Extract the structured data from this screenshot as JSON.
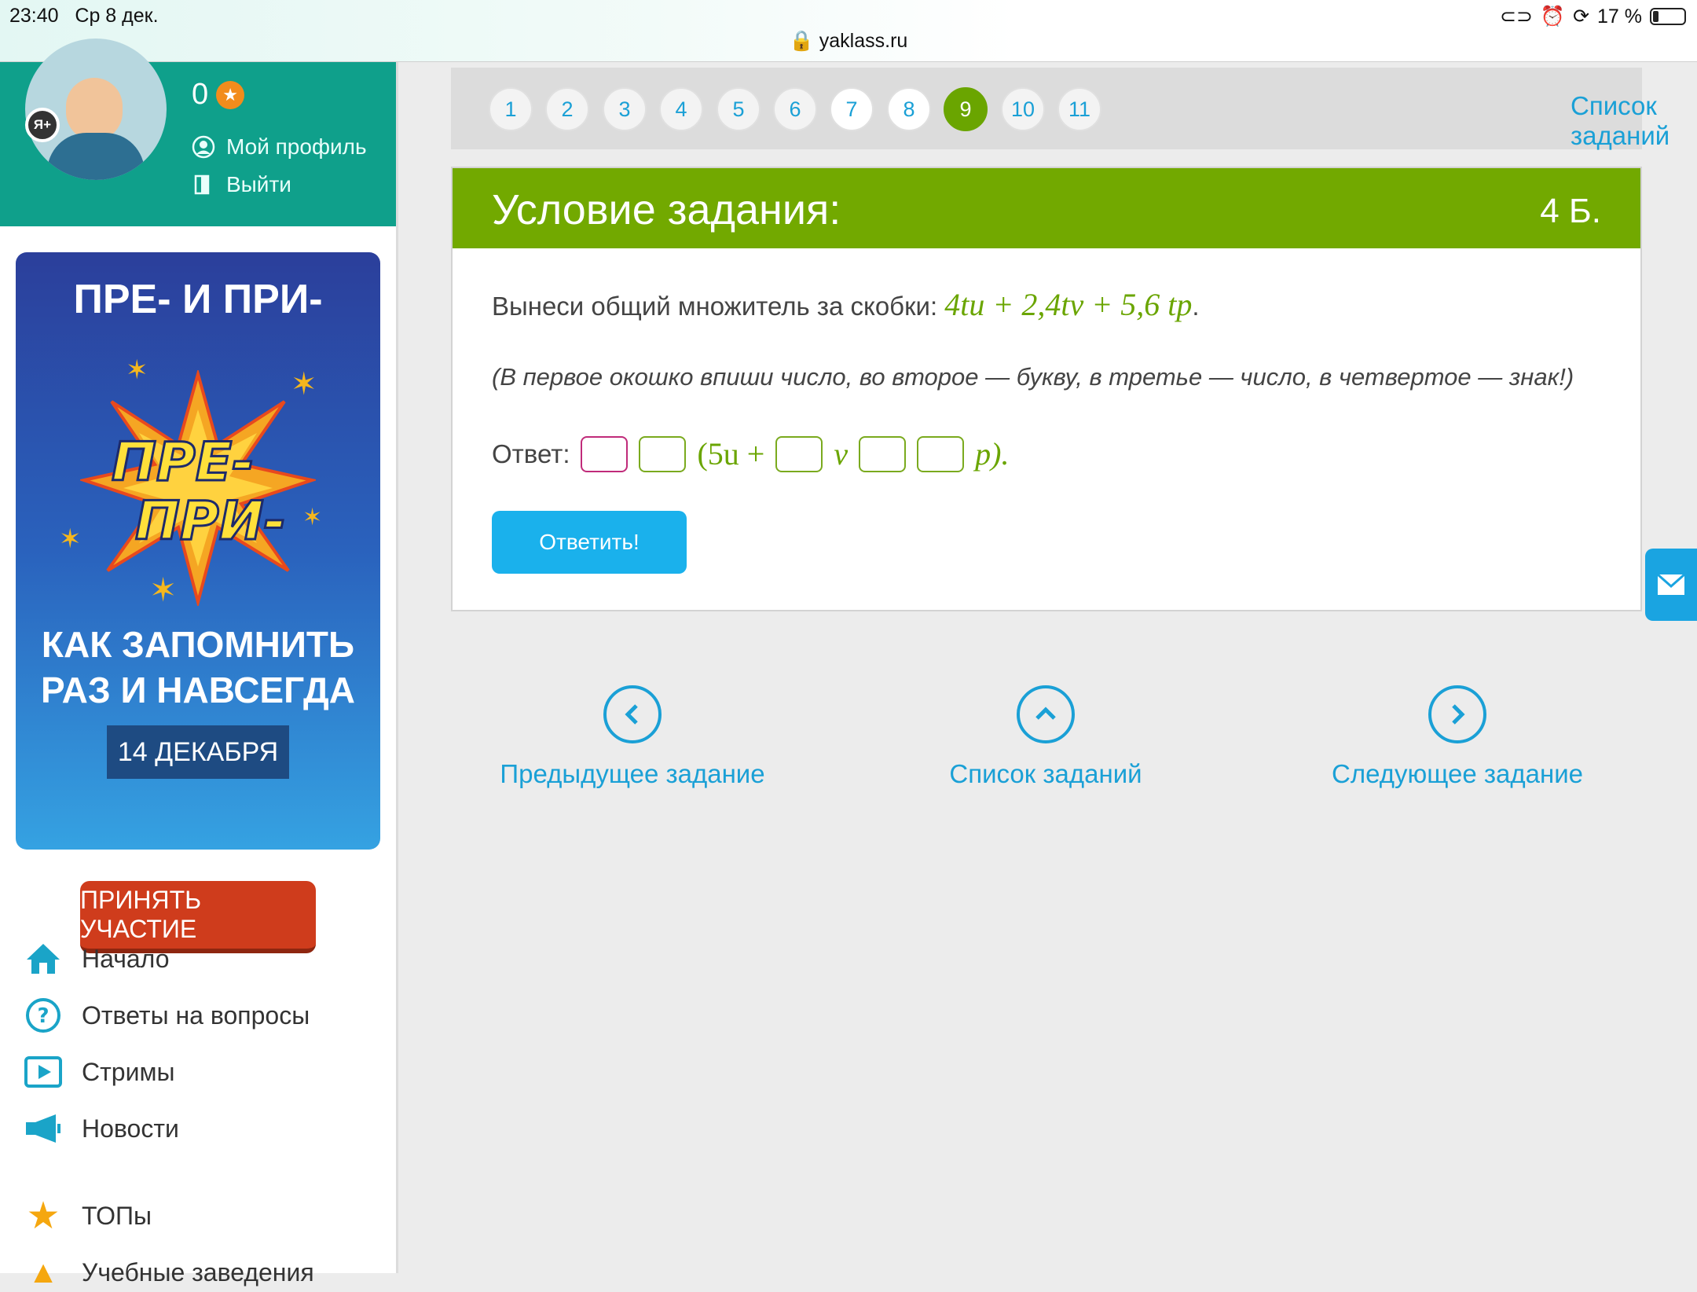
{
  "status_bar": {
    "time": "23:40",
    "date": "Ср 8 дек.",
    "url": "yaklass.ru",
    "battery": "17 %"
  },
  "profile": {
    "badge": "Я+",
    "points": "0",
    "my_profile": "Мой профиль",
    "logout": "Выйти"
  },
  "banner": {
    "title": "ПРЕ- И ПРИ-",
    "burst_line1": "ПРЕ-",
    "burst_line2": "ПРИ-",
    "subtitle_line1": "КАК ЗАПОМНИТЬ",
    "subtitle_line2": "РАЗ И НАВСЕГДА",
    "date": "14 ДЕКАБРЯ",
    "button": "ПРИНЯТЬ УЧАСТИЕ"
  },
  "nav": [
    {
      "label": "Начало",
      "icon": "home-icon"
    },
    {
      "label": "Ответы на вопросы",
      "icon": "question-icon"
    },
    {
      "label": "Стримы",
      "icon": "play-icon"
    },
    {
      "label": "Новости",
      "icon": "megaphone-icon"
    },
    {
      "label": "ТОПы",
      "icon": "star-icon"
    },
    {
      "label": "Учебные заведения",
      "icon": "school-icon"
    }
  ],
  "pager": {
    "pages": [
      "1",
      "2",
      "3",
      "4",
      "5",
      "6",
      "7",
      "8",
      "9",
      "10",
      "11"
    ],
    "active": "9",
    "list_label": "Список заданий"
  },
  "task": {
    "header": "Условие задания:",
    "score": "4 Б.",
    "question_text": "Вынеси общий множитель за скобки: ",
    "expression": "4tu + 2,4tv + 5,6 tp",
    "hint": "(В первое окошко впиши число, во второе — букву, в третье — число, в четвертое — знак!)",
    "answer_label": "Ответ:",
    "answer_part1": "(5u +",
    "answer_part2": "v",
    "answer_part3": "p).",
    "submit": "Ответить!"
  },
  "bottom_nav": {
    "prev": "Предыдущее задание",
    "list": "Список заданий",
    "next": "Следующее задание"
  },
  "colors": {
    "teal": "#0fa08b",
    "green": "#72a900",
    "blue": "#1ab1ec",
    "link": "#1aa0d6"
  }
}
